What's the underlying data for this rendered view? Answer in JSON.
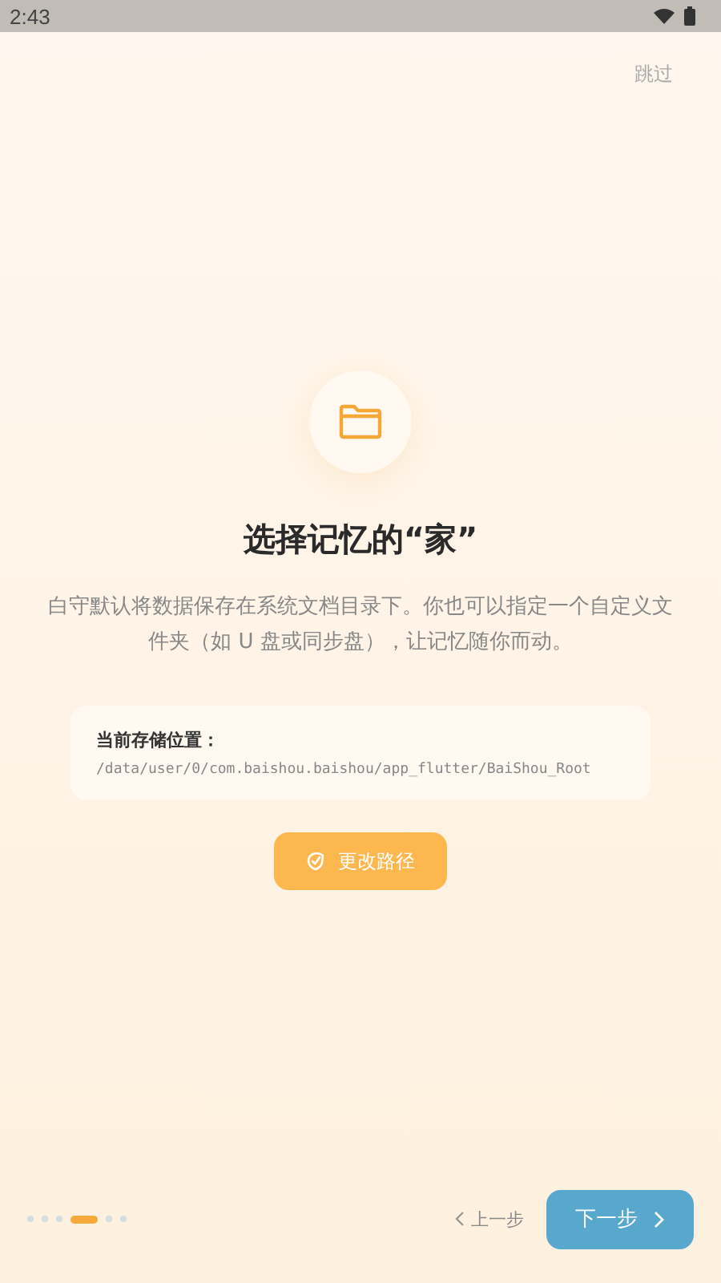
{
  "status_bar": {
    "time": "2:43"
  },
  "skip": "跳过",
  "title": "选择记忆的“家”",
  "description": "白守默认将数据保存在系统文档目录下。你也可以指定一个自定义文件夹（如 U 盘或同步盘），让记忆随你而动。",
  "storage_card": {
    "label": "当前存储位置：",
    "path": "/data/user/0/com.baishou.baishou/app_flutter/BaiShou_Root"
  },
  "change_button": "更改路径",
  "page_dots": [
    {
      "selected": false
    },
    {
      "selected": false
    },
    {
      "selected": false
    },
    {
      "selected": true
    },
    {
      "selected": false
    },
    {
      "selected": false
    }
  ],
  "back_button": "上一步",
  "next_button": "下一步"
}
